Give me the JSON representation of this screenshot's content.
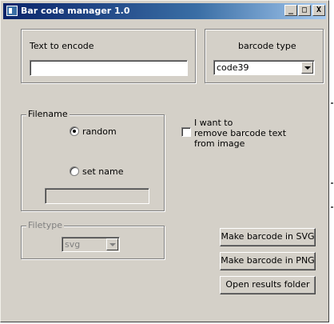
{
  "window": {
    "title": "Bar code manager 1.0",
    "controls": {
      "minimize": "_",
      "maximize": "□",
      "close": "X"
    }
  },
  "text_group": {
    "label": "Text to encode",
    "input_value": ""
  },
  "barcode_group": {
    "label": "barcode type",
    "selected": "code39"
  },
  "filename_group": {
    "legend": "Filename",
    "random_label": "random",
    "random_checked": true,
    "set_name_label": "set name",
    "set_name_checked": false,
    "name_value": ""
  },
  "checkbox": {
    "line1": "I want to",
    "line2": "remove barcode text",
    "line3": "from image",
    "checked": false
  },
  "filetype_group": {
    "legend": "Filetype",
    "selected": "svg"
  },
  "buttons": {
    "svg": "Make barcode in SVG",
    "png": "Make barcode in PNG",
    "open": "Open results folder"
  },
  "icons": {
    "app": "app-icon",
    "dropdown": "chevron-down-icon"
  }
}
